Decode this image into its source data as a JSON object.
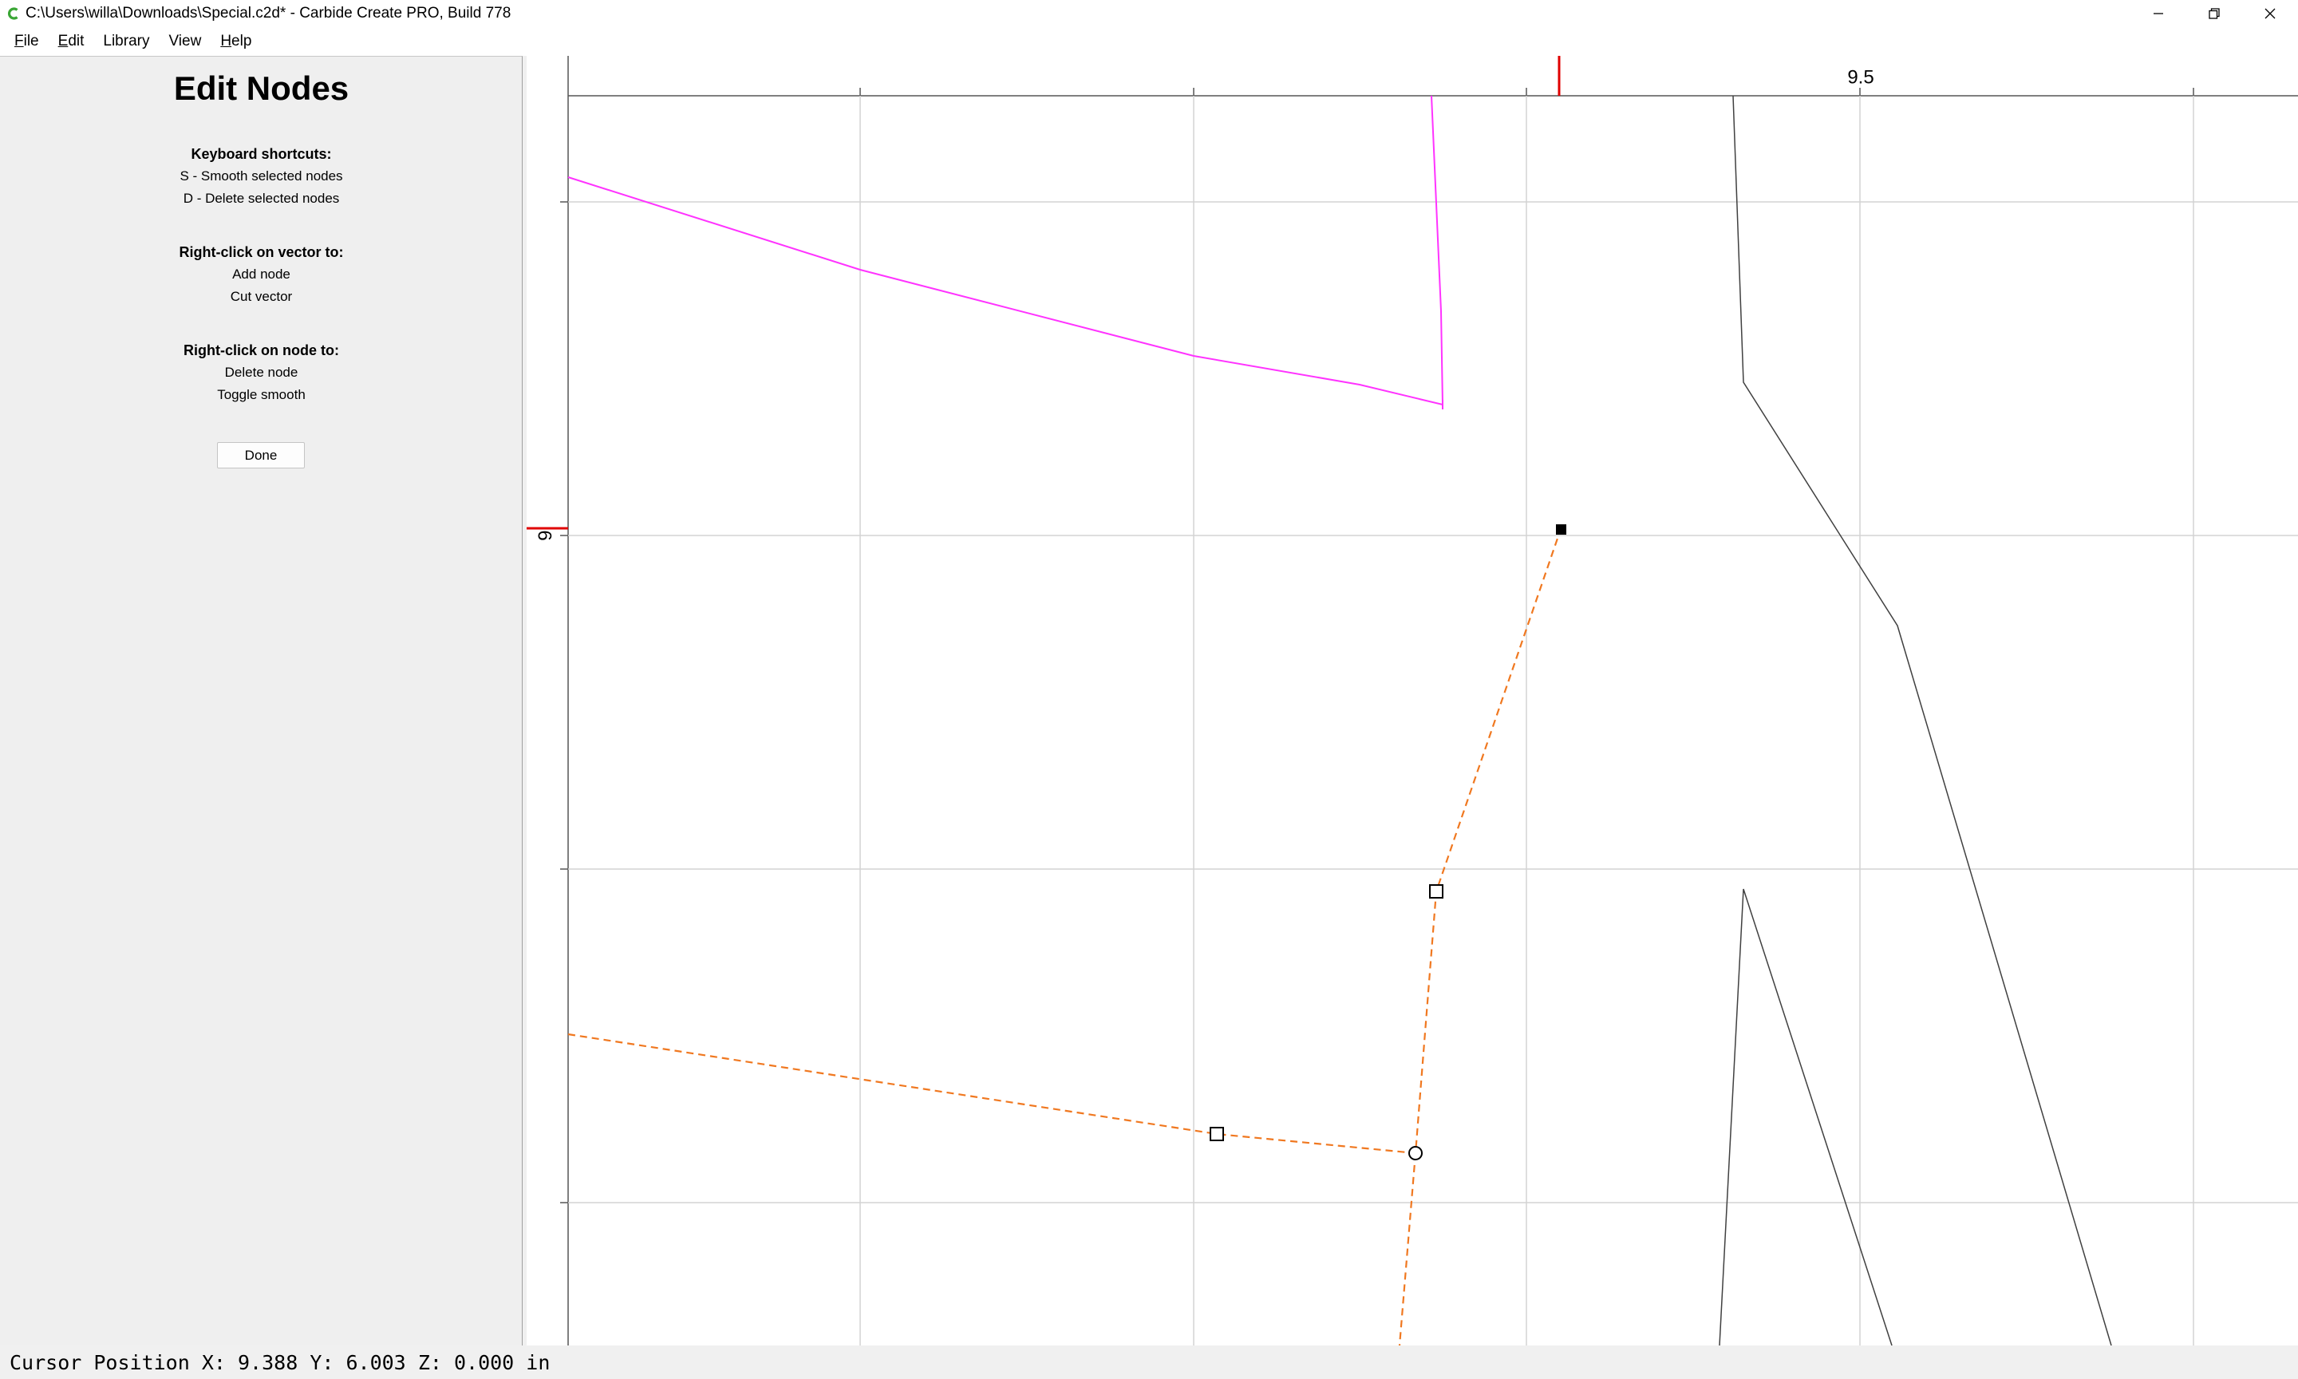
{
  "window": {
    "title": "C:\\Users\\willa\\Downloads\\Special.c2d* - Carbide Create PRO, Build 778",
    "app_icon": "carbide-c-icon",
    "app_icon_color": "#3aa635",
    "controls": [
      "minimize-icon",
      "restore-icon",
      "close-icon"
    ]
  },
  "menu": {
    "items": [
      {
        "id": "file",
        "accel": "F",
        "rest": "ile"
      },
      {
        "id": "edit",
        "accel": "E",
        "rest": "dit"
      },
      {
        "id": "library",
        "accel": "",
        "rest": "Library"
      },
      {
        "id": "view",
        "accel": "",
        "rest": "View"
      },
      {
        "id": "help",
        "accel": "H",
        "rest": "elp"
      }
    ]
  },
  "panel": {
    "title": "Edit Nodes",
    "shortcuts": {
      "header": "Keyboard shortcuts:",
      "lines": [
        "S - Smooth selected nodes",
        "D - Delete selected nodes"
      ]
    },
    "vector_menu": {
      "header": "Right-click on vector to:",
      "lines": [
        "Add node",
        "Cut vector"
      ]
    },
    "node_menu": {
      "header": "Right-click on node to:",
      "lines": [
        "Delete node",
        "Toggle smooth"
      ]
    },
    "done_label": "Done"
  },
  "canvas": {
    "ruler_labels": {
      "x": "9.5",
      "y": "6"
    },
    "colors": {
      "grid": "#d4d4d4",
      "ruler_marker": "#e00000",
      "selected_path": "#f07820",
      "magenta_path": "#ff33ff",
      "other_path": "#404040"
    }
  },
  "status": {
    "prefix": "Cursor Position",
    "x": "X: 9.388",
    "y": "Y: 6.003",
    "z": "Z: 0.000",
    "units": "in"
  }
}
